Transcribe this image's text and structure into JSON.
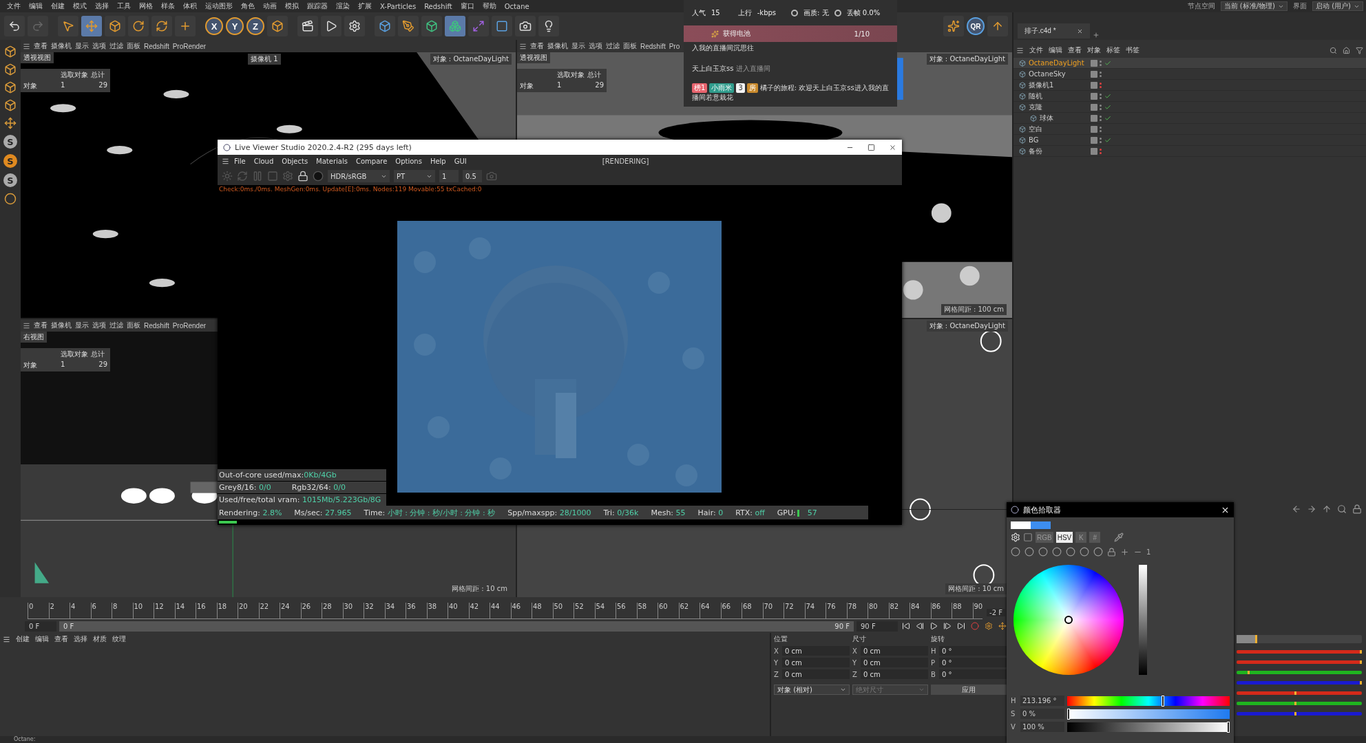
{
  "menu_bar": {
    "items": [
      "文件",
      "编辑",
      "创建",
      "模式",
      "选择",
      "工具",
      "网格",
      "样条",
      "体积",
      "运动图形",
      "角色",
      "动画",
      "模拟",
      "跟踪器",
      "渲染",
      "扩展",
      "X-Particles",
      "Redshift",
      "窗口",
      "帮助",
      "Octane"
    ],
    "node_space_label": "节点空间",
    "node_space_value": "当前 (标准/物理)",
    "layout_label": "界面",
    "layout_value": "启动 (用户)"
  },
  "toolbar": {
    "axis_buttons": [
      "X",
      "Y",
      "Z"
    ],
    "badge": "QR"
  },
  "status_bar": {
    "text": "Octane:"
  },
  "left_tools": {
    "letters": [
      "S",
      "S",
      "S"
    ]
  },
  "viewports": [
    {
      "kind": "dark",
      "label": "透视视图",
      "menu": [
        "查看",
        "摄像机",
        "显示",
        "选项",
        "过滤",
        "面板",
        "Redshift",
        "ProRender"
      ],
      "camera": "摄像机 1",
      "object": "对象 : OctaneDayLight",
      "stats": {
        "header_1": "选取对象",
        "header_2": "总计",
        "row_label": "对象",
        "selected": "1",
        "total": "29"
      }
    },
    {
      "kind": "grey",
      "label": "透视视图",
      "menu": [
        "查看",
        "摄像机",
        "显示",
        "选项",
        "过滤",
        "面板",
        "Redshift",
        "Pro"
      ],
      "object": "对象 : OctaneDayLight",
      "grid": "网格间距 : 100 cm",
      "stats": {
        "header_1": "选取对象",
        "header_2": "总计",
        "row_label": "对象",
        "selected": "1",
        "total": "29"
      }
    },
    {
      "kind": "side",
      "label": "右视图",
      "menu": [
        "查看",
        "摄像机",
        "显示",
        "选项",
        "过滤",
        "面板",
        "Redshift",
        "ProRender"
      ],
      "grid": "网格间距 : 10 cm",
      "stats": {
        "header_1": "选取对象",
        "header_2": "总计",
        "row_label": "对象",
        "selected": "1",
        "total": "29"
      }
    },
    {
      "kind": "wheels",
      "object": "对象 : OctaneDayLight",
      "grid": "网格间距 : 10 cm"
    }
  ],
  "timeline": {
    "ticks": [
      "0",
      "2",
      "4",
      "6",
      "8",
      "10",
      "12",
      "14",
      "16",
      "18",
      "20",
      "22",
      "24",
      "26",
      "28",
      "30",
      "32",
      "34",
      "36",
      "38",
      "40",
      "42",
      "44",
      "46",
      "48",
      "50",
      "52",
      "54",
      "56",
      "58",
      "60",
      "62",
      "64",
      "66",
      "68",
      "70",
      "72",
      "74",
      "76",
      "78",
      "80",
      "82",
      "84",
      "86",
      "88",
      "90"
    ],
    "current": "-2 F",
    "start": "0 F",
    "range_start": "0 F",
    "range_end": "90 F",
    "end": "90 F"
  },
  "materials": {
    "menu": [
      "创建",
      "编辑",
      "查看",
      "选择",
      "材质",
      "纹理"
    ]
  },
  "coordinates": {
    "headers": [
      "位置",
      "尺寸",
      "旋转"
    ],
    "rows": [
      {
        "pos_axis": "X",
        "pos": "0 cm",
        "size_axis": "X",
        "size": "0 cm",
        "rot_axis": "H",
        "rot": "0 °"
      },
      {
        "pos_axis": "Y",
        "pos": "0 cm",
        "size_axis": "Y",
        "size": "0 cm",
        "rot_axis": "P",
        "rot": "0 °"
      },
      {
        "pos_axis": "Z",
        "pos": "0 cm",
        "size_axis": "Z",
        "size": "0 cm",
        "rot_axis": "B",
        "rot": "0 °"
      }
    ],
    "mode": "对象 (相对)",
    "size_mode": "绝对尺寸",
    "apply": "应用"
  },
  "object_manager": {
    "tab": "排子.c4d *",
    "menu": [
      "文件",
      "编辑",
      "查看",
      "对象",
      "标签",
      "书签"
    ],
    "objects": [
      {
        "name": "OctaneDayLight",
        "selected": true,
        "checked": true,
        "render_off": false
      },
      {
        "name": "OctaneSky",
        "selected": false,
        "checked": false,
        "render_off": false
      },
      {
        "name": "摄像机1",
        "selected": false,
        "checked": false,
        "render_off": true
      },
      {
        "name": "随机",
        "selected": false,
        "checked": true,
        "render_off": false
      },
      {
        "name": "克隆",
        "selected": false,
        "checked": true,
        "render_off": false,
        "children": [
          {
            "name": "球体",
            "selected": false,
            "checked": true,
            "render_off": false
          }
        ]
      },
      {
        "name": "空白",
        "selected": false,
        "checked": false,
        "render_off": false
      },
      {
        "name": "BG",
        "selected": false,
        "checked": true,
        "render_off": false
      },
      {
        "name": "备份",
        "selected": false,
        "checked": false,
        "render_off": true
      }
    ]
  },
  "attribute_sliders": [
    {
      "color": "#444444",
      "level": 0.15
    },
    {
      "color": "#d42a1a",
      "level": 1
    },
    {
      "color": "#d42a1a",
      "level": 1
    },
    {
      "color": "#1fb41f",
      "level": 0.09
    },
    {
      "color": "#1a1ad0",
      "level": 1
    },
    {
      "color": "#d42a1a",
      "level": 0.47
    },
    {
      "color": "#1fb41f",
      "level": 0.47
    },
    {
      "color": "#1a1ad0",
      "level": 0.47
    }
  ],
  "live_viewer": {
    "title": "Live Viewer Studio 2020.2.4-R2 (295 days left)",
    "menu": [
      "File",
      "Cloud",
      "Objects",
      "Materials",
      "Compare",
      "Options",
      "Help",
      "GUI"
    ],
    "status": "[RENDERING]",
    "tonemap": "HDR/sRGB",
    "kernel": "PT",
    "value_1": "1",
    "value_2": "0.5",
    "check_line": "Check:0ms./0ms. MeshGen:0ms. Update[E]:0ms. Nodes:119 Movable:55 txCached:0",
    "memory": {
      "label": "Out-of-core used/max:",
      "value": "0Kb/4Gb"
    },
    "textures": [
      {
        "label": "Grey8/16:",
        "value": "0/0"
      },
      {
        "label": "Rgb32/64:",
        "value": "0/0"
      }
    ],
    "vram": {
      "label": "Used/free/total vram:",
      "value": "1015Mb/5.223Gb/8G"
    },
    "stats": [
      {
        "label": "Rendering:",
        "value": "2.8%"
      },
      {
        "label": "Ms/sec:",
        "value": "27.965"
      },
      {
        "label": "Time:",
        "value": "小时 : 分钟 : 秒/小时 : 分钟 : 秒"
      },
      {
        "label": "Spp/maxspp:",
        "value": "28/1000"
      },
      {
        "label": "Tri:",
        "value": "0/36k"
      },
      {
        "label": "Mesh:",
        "value": "55"
      },
      {
        "label": "Hair:",
        "value": "0"
      },
      {
        "label": "RTX:",
        "value": "off"
      }
    ],
    "gpu": {
      "label": "GPU:",
      "value": "57"
    },
    "progress": {
      "level": 0.028
    }
  },
  "stream_overlay": {
    "popularity_label": "人气",
    "popularity": "15",
    "upload_label": "上行",
    "upload": "-kbps",
    "quality": "画质: 无",
    "drop": "丢帧 0.0%",
    "reward": "获得电池",
    "reward_count": "1/10",
    "messages": [
      {
        "kind": "partial",
        "text": "入我的直播间沉思往"
      },
      {
        "kind": "enter",
        "user": "天上白玉京ss",
        "text": "进入直播间"
      },
      {
        "kind": "chat",
        "badges": [
          {
            "text": "榜1",
            "color": "#e8646e"
          },
          {
            "text": "小雨米",
            "color": "#2f9c8c"
          },
          {
            "text": "3",
            "color": "#f4f4f4"
          },
          {
            "text": "房",
            "color": "#c98a2c"
          }
        ],
        "text": "橘子的旅程: 欢迎天上白玉京ss进入我的直播间若意栽花"
      }
    ]
  },
  "color_picker": {
    "title": "颜色拾取器",
    "swatches": [
      {
        "color": "#ffffff"
      },
      {
        "color": "#3d8ef0"
      }
    ],
    "modes": [
      {
        "label": "RGB",
        "selected": false
      },
      {
        "label": "HSV",
        "selected": true
      },
      {
        "label": "K",
        "selected": false
      },
      {
        "label": "#",
        "selected": false
      }
    ],
    "count": "1",
    "channels": [
      {
        "kind": "hue",
        "name": "H",
        "value": "213.196 °",
        "level": 0.592
      },
      {
        "kind": "saturation",
        "name": "S",
        "value": "0 %",
        "level": 0
      },
      {
        "kind": "value",
        "name": "V",
        "value": "100 %",
        "level": 1
      }
    ]
  }
}
